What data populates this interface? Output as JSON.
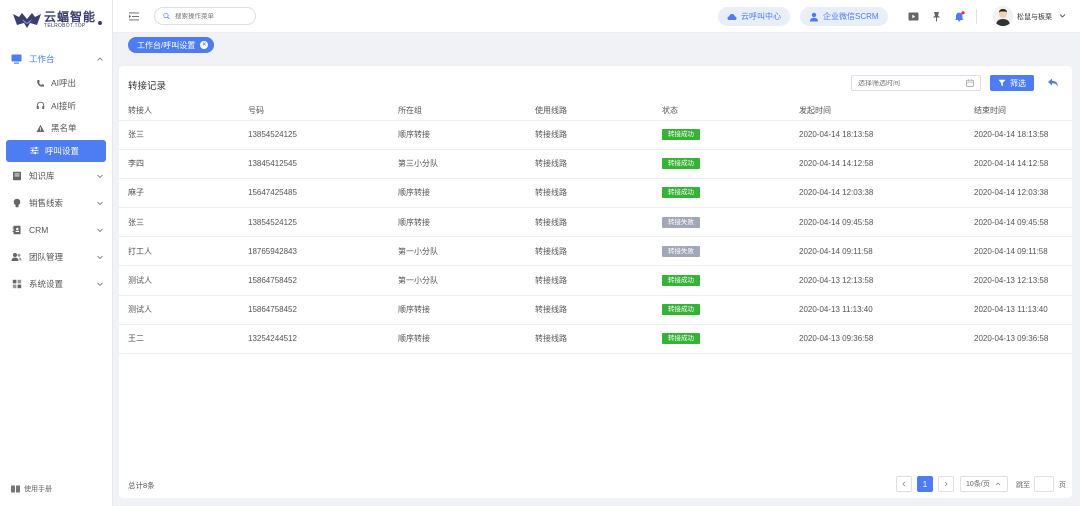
{
  "brand": {
    "name_cn": "云蝠智能",
    "name_en": "TELROBOT.TOP"
  },
  "sidebar": {
    "menu": [
      {
        "label": "工作台",
        "icon": "monitor-icon",
        "open": true,
        "children": [
          {
            "label": "AI呼出",
            "icon": "phone-icon"
          },
          {
            "label": "AI接听",
            "icon": "headset-icon"
          },
          {
            "label": "黑名单",
            "icon": "warning-icon"
          },
          {
            "label": "呼叫设置",
            "icon": "sliders-icon",
            "active": true
          }
        ]
      },
      {
        "label": "知识库",
        "icon": "book-icon"
      },
      {
        "label": "销售线索",
        "icon": "bulb-icon"
      },
      {
        "label": "CRM",
        "icon": "contacts-icon"
      },
      {
        "label": "团队管理",
        "icon": "team-icon"
      },
      {
        "label": "系统设置",
        "icon": "grid-icon"
      }
    ],
    "footer_label": "使用手册"
  },
  "header": {
    "search_placeholder": "搜索操作菜单",
    "btn_call_center": "云呼叫中心",
    "btn_scrm": "企业微信SCRM",
    "username": "松鼠与板栗"
  },
  "breadcrumb": {
    "label": "工作台/呼叫设置"
  },
  "card": {
    "title": "转接记录",
    "date_placeholder": "选择筛选时间",
    "filter_label": "筛选"
  },
  "table": {
    "columns": [
      "转接人",
      "号码",
      "所在组",
      "使用线路",
      "状态",
      "发起时间",
      "结束时间"
    ],
    "rows": [
      {
        "person": "张三",
        "phone": "13854524125",
        "group": "顺序转接",
        "line": "转接线路",
        "status": "转接成功",
        "ok": true,
        "start": "2020-04-14  18:13:58",
        "end": "2020-04-14  18:13:58"
      },
      {
        "person": "李四",
        "phone": "13845412545",
        "group": "第三小分队",
        "line": "转接线路",
        "status": "转接成功",
        "ok": true,
        "start": "2020-04-14  14:12:58",
        "end": "2020-04-14  14:12:58"
      },
      {
        "person": "麻子",
        "phone": "15647425485",
        "group": "顺序转接",
        "line": "转接线路",
        "status": "转接成功",
        "ok": true,
        "start": "2020-04-14  12:03:38",
        "end": "2020-04-14  12:03:38"
      },
      {
        "person": "张三",
        "phone": "13854524125",
        "group": "顺序转接",
        "line": "转接线路",
        "status": "转接失败",
        "ok": false,
        "start": "2020-04-14  09:45:58",
        "end": "2020-04-14  09:45:58"
      },
      {
        "person": "打工人",
        "phone": "18765942843",
        "group": "第一小分队",
        "line": "转接线路",
        "status": "转接失败",
        "ok": false,
        "start": "2020-04-14  09:11:58",
        "end": "2020-04-14  09:11:58"
      },
      {
        "person": "测试人",
        "phone": "15864758452",
        "group": "第一小分队",
        "line": "转接线路",
        "status": "转接成功",
        "ok": true,
        "start": "2020-04-13  12:13:58",
        "end": "2020-04-13  12:13:58"
      },
      {
        "person": "测试人",
        "phone": "15864758452",
        "group": "顺序转接",
        "line": "转接线路",
        "status": "转接成功",
        "ok": true,
        "start": "2020-04-13  11:13:40",
        "end": "2020-04-13  11:13:40"
      },
      {
        "person": "王二",
        "phone": "13254244512",
        "group": "顺序转接",
        "line": "转接线路",
        "status": "转接成功",
        "ok": true,
        "start": "2020-04-13  09:36:58",
        "end": "2020-04-13  09:36:58"
      }
    ]
  },
  "pagination": {
    "total": "总计8条",
    "current_page": "1",
    "page_size": "10条/页",
    "jump_prefix": "跳至",
    "jump_suffix": "页"
  },
  "colors": {
    "primary": "#4d7cf3",
    "success": "#36b336",
    "fail": "#a0a8b8",
    "brand": "#3a3f6e"
  }
}
